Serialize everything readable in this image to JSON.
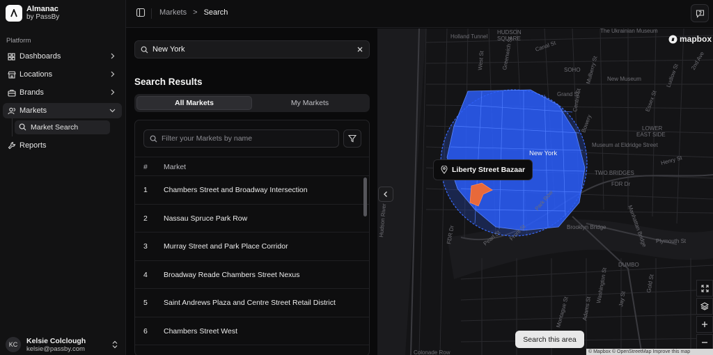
{
  "brand": {
    "name": "Almanac",
    "sub": "by PassBy",
    "logo_icon": "almanac-logo-icon"
  },
  "sidebar": {
    "section_label": "Platform",
    "items": [
      {
        "label": "Dashboards",
        "icon": "grid-icon"
      },
      {
        "label": "Locations",
        "icon": "store-icon"
      },
      {
        "label": "Brands",
        "icon": "briefcase-icon"
      },
      {
        "label": "Markets",
        "icon": "users-icon"
      },
      {
        "label": "Reports",
        "icon": "wrench-icon"
      }
    ],
    "sub_items": [
      {
        "label": "Market Search",
        "icon": "search-icon"
      }
    ]
  },
  "user": {
    "initials": "KC",
    "name": "Kelsie Colclough",
    "email": "kelsie@passby.com"
  },
  "breadcrumb": {
    "parent": "Markets",
    "separator": ">",
    "current": "Search"
  },
  "search": {
    "value": "New York"
  },
  "results": {
    "title": "Search Results",
    "tabs": [
      "All Markets",
      "My Markets"
    ],
    "active_tab": "All Markets",
    "filter_placeholder": "Filter your Markets by name",
    "columns": [
      "#",
      "Market"
    ],
    "rows": [
      {
        "n": "1",
        "market": "Chambers Street and Broadway Intersection"
      },
      {
        "n": "2",
        "market": "Nassau Spruce Park Row"
      },
      {
        "n": "3",
        "market": "Murray Street and Park Place Corridor"
      },
      {
        "n": "4",
        "market": "Broadway Reade Chambers Street Nexus"
      },
      {
        "n": "5",
        "market": "Saint Andrews Plaza and Centre Street Retail District"
      },
      {
        "n": "6",
        "market": "Chambers Street West"
      }
    ]
  },
  "map": {
    "tooltip": "Liberty Street Bazaar",
    "search_area_label": "Search this area",
    "logo_text": "mapbox",
    "attribution": "© Mapbox © OpenStreetMap Improve this map",
    "labels": {
      "holland": "Holland Tunnel",
      "hudson_sq": "HUDSON",
      "hudson_sq2": "SQUARE",
      "ukrainian": "The Ukrainian Museum",
      "soho": "SOHO",
      "new_museum": "New Museum",
      "grand": "Grand St",
      "new_york": "New York",
      "lower_east": "LOWER",
      "east_side": "EAST SIDE",
      "two_bridges": "TWO BRIDGES",
      "fdr": "FDR Dr",
      "brooklyn": "Brooklyn Bridge",
      "dumbo": "DUMBO",
      "plymouth": "Plymouth St",
      "hudson_river": "Hudson River",
      "pearl": "Pearl St",
      "manhattan_br": "Manhattan Bridge",
      "museum_eldridge": "Museum at Eldridge Street",
      "essex": "Essex St",
      "bowery": "Bowery",
      "mulberry": "Mulberry St",
      "centre": "Centre St",
      "canal": "Canal St",
      "west": "West St",
      "greenwich": "Greenwich St",
      "ludlow": "Ludlow St",
      "montague": "Montague St",
      "adams": "Adams St",
      "jay": "Jay St",
      "washington": "Washington St",
      "gold": "Gold St",
      "front": "Front St",
      "park_row": "Park Row",
      "second_ave": "2nd Ave",
      "henry": "Henry St",
      "colonia": "Colonade Row"
    },
    "colors": {
      "coverage": "#2a5cf5",
      "selected": "#e8693a"
    },
    "controls": [
      "fullscreen-icon",
      "layers-icon",
      "zoom-in-icon",
      "zoom-out-icon"
    ]
  }
}
